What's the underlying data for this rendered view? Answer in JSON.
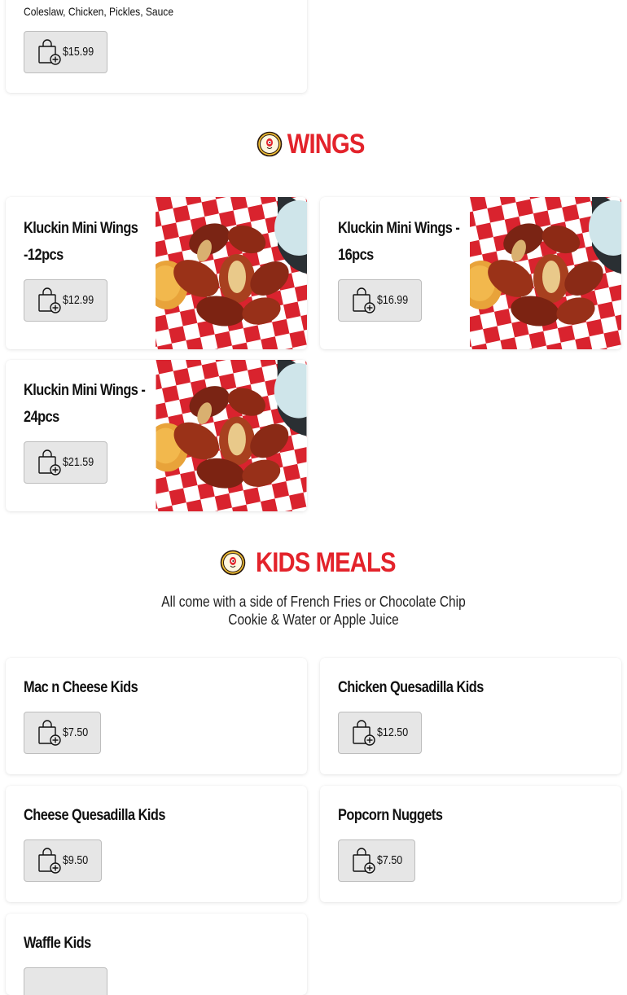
{
  "top_item": {
    "description": "Coleslaw, Chicken, Pickles, Sauce",
    "price": "$15.99"
  },
  "wings": {
    "title": "WINGS",
    "items": [
      {
        "line1": "Kluckin Mini Wings",
        "line2": "-12pcs",
        "price": "$12.99"
      },
      {
        "line1": "Kluckin Mini Wings -",
        "line2": "16pcs",
        "price": "$16.99"
      },
      {
        "line1": "Kluckin Mini Wings -",
        "line2": "24pcs",
        "price": "$21.59"
      }
    ]
  },
  "kids_meals": {
    "title": "KIDS MEALS",
    "subtitle_line1": "All come with a side of French Fries or Chocolate Chip",
    "subtitle_line2": "Cookie & Water or Apple Juice",
    "items": [
      {
        "name": "Mac n Cheese Kids",
        "price": "$7.50"
      },
      {
        "name": "Chicken Quesadilla Kids",
        "price": "$12.50"
      },
      {
        "name": "Cheese Quesadilla Kids",
        "price": "$9.50"
      },
      {
        "name": "Popcorn Nuggets",
        "price": "$7.50"
      },
      {
        "name": "Waffle Kids",
        "price": ""
      }
    ]
  },
  "icons": {
    "add_to_bag": "shopping-bag-plus-icon",
    "section_logo": "chicken-logo-icon"
  },
  "colors": {
    "accent": "#e3232b",
    "button_bg": "#e6e6e6",
    "checker_red": "#d9232e"
  }
}
